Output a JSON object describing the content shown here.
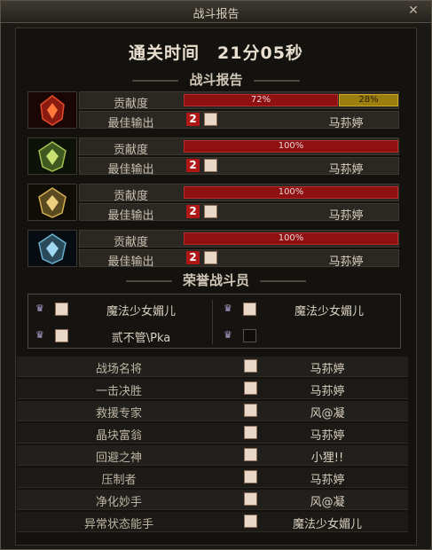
{
  "window": {
    "title": "战斗报告"
  },
  "clear_time": "通关时间　21分05秒",
  "battle_section": {
    "title": "战斗报告"
  },
  "labels": {
    "contribution": "贡献度",
    "best_damage": "最佳输出"
  },
  "bosses": [
    {
      "icon": "red-boss-icon",
      "contribution_pct": 72,
      "contribution_label": "72%",
      "second_pct": 28,
      "second_label": "28%",
      "best_count": "2",
      "best_player": "马荪婷"
    },
    {
      "icon": "green-boss-icon",
      "contribution_pct": 100,
      "contribution_label": "100%",
      "best_count": "2",
      "best_player": "马荪婷"
    },
    {
      "icon": "gold-boss-icon",
      "contribution_pct": 100,
      "contribution_label": "100%",
      "best_count": "2",
      "best_player": "马荪婷"
    },
    {
      "icon": "blue-boss-icon",
      "contribution_pct": 100,
      "contribution_label": "100%",
      "best_count": "2",
      "best_player": "马荪婷"
    }
  ],
  "honor_section": {
    "title": "荣誉战斗员",
    "members": [
      {
        "name": "魔法少女媚儿"
      },
      {
        "name": "魔法少女媚儿"
      },
      {
        "name": "贰不管\\Pka"
      },
      {
        "name": ""
      }
    ]
  },
  "awards": [
    {
      "title": "战场名将",
      "player": "马荪婷"
    },
    {
      "title": "一击决胜",
      "player": "马荪婷"
    },
    {
      "title": "救援专家",
      "player": "风@凝"
    },
    {
      "title": "晶块富翁",
      "player": "马荪婷"
    },
    {
      "title": "回避之神",
      "player": "小狸!!"
    },
    {
      "title": "压制者",
      "player": "马荪婷"
    },
    {
      "title": "净化妙手",
      "player": "风@凝"
    },
    {
      "title": "异常状态能手",
      "player": "魔法少女媚儿"
    }
  ],
  "colors": {
    "bar_red": "#8e1010",
    "bar_gold": "#9b7d10"
  }
}
